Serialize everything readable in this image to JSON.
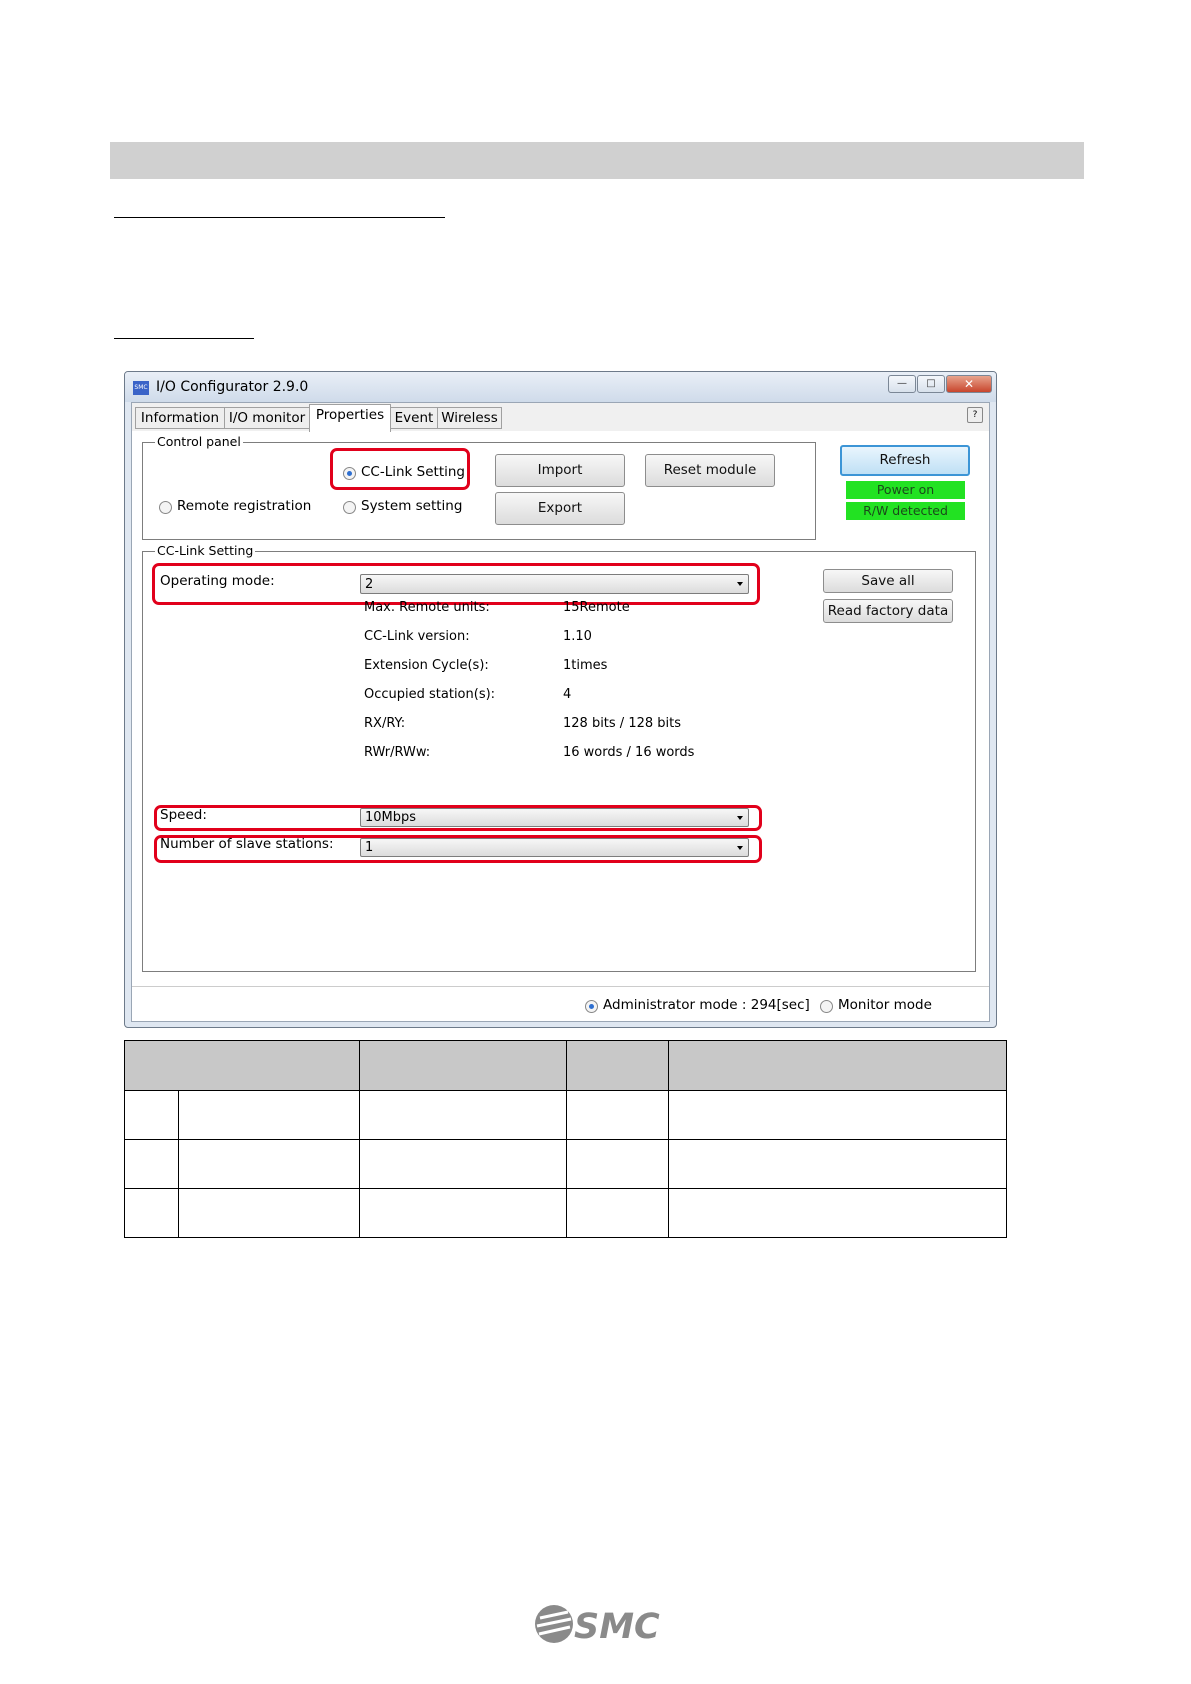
{
  "window": {
    "title": "I/O Configurator 2.9.0",
    "icon_text": "SMC"
  },
  "tabs": [
    {
      "label": "Information"
    },
    {
      "label": "I/O monitor"
    },
    {
      "label": "Properties"
    },
    {
      "label": "Event"
    },
    {
      "label": "Wireless"
    }
  ],
  "control_panel": {
    "legend": "Control panel",
    "cc_link_setting": "CC-Link Setting",
    "remote_registration": "Remote registration",
    "system_setting": "System setting",
    "import": "Import",
    "export": "Export",
    "reset_module": "Reset module"
  },
  "refresh": "Refresh",
  "status": {
    "power_on": "Power on",
    "rw_detected": "R/W detected"
  },
  "cc_link": {
    "legend": "CC-Link Setting",
    "operating_mode_label": "Operating mode:",
    "operating_mode_value": "2",
    "save_all": "Save all",
    "read_factory_data": "Read factory data",
    "info": [
      {
        "label": "Max. Remote units:",
        "value": "15Remote"
      },
      {
        "label": "CC-Link version:",
        "value": "1.10"
      },
      {
        "label": "Extension Cycle(s):",
        "value": "1times"
      },
      {
        "label": "Occupied station(s):",
        "value": "4"
      },
      {
        "label": "RX/RY:",
        "value": "128 bits / 128 bits"
      },
      {
        "label": "RWr/RWw:",
        "value": "16 words / 16 words"
      }
    ],
    "speed_label": "Speed:",
    "speed_value": "10Mbps",
    "slave_label": "Number of slave stations:",
    "slave_value": "1"
  },
  "mode": {
    "admin": "Administrator mode : 294[sec]",
    "monitor": "Monitor mode"
  },
  "colors": {
    "highlight_red": "#e1001b",
    "status_green": "#22e222",
    "refresh_blue": "#3c95d6"
  }
}
